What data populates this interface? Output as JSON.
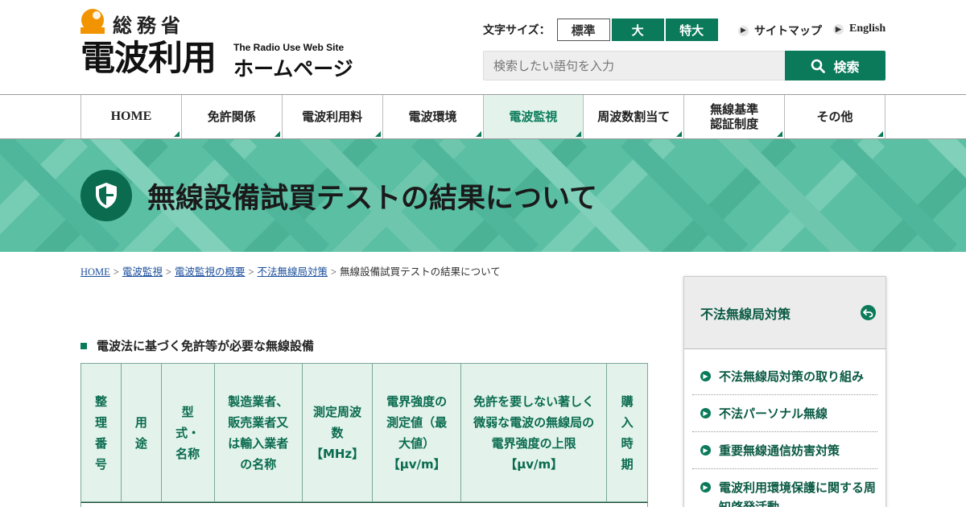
{
  "colors": {
    "brand_green": "#0a7a5a",
    "logo_orange": "#f29400",
    "link_blue": "#1b4f9c"
  },
  "header": {
    "logo": {
      "ministry": "総務省",
      "main": "電波利用",
      "sub_en": "The Radio Use Web Site",
      "sub_ja": "ホームページ"
    },
    "font_size": {
      "label": "文字サイズ：",
      "standard": "標準",
      "large": "大",
      "extra_large": "特大"
    },
    "links": {
      "sitemap": "サイトマップ",
      "english": "English"
    },
    "search": {
      "placeholder": "検索したい語句を入力",
      "button": "検索",
      "icon": "search-icon"
    }
  },
  "nav": {
    "items": [
      {
        "label": "HOME"
      },
      {
        "label": "免許関係"
      },
      {
        "label": "電波利用料"
      },
      {
        "label": "電波環境"
      },
      {
        "label": "電波監視",
        "active": true
      },
      {
        "label": "周波数割当て"
      },
      {
        "label": "無線基準\n認証制度"
      },
      {
        "label": "その他"
      }
    ]
  },
  "banner": {
    "title": "無線設備試買テストの結果について",
    "icon": "shield-icon"
  },
  "breadcrumb": {
    "items": [
      {
        "label": "HOME"
      },
      {
        "label": "電波監視"
      },
      {
        "label": "電波監視の概要"
      },
      {
        "label": "不法無線局対策"
      }
    ],
    "separator": ">",
    "current": "無線設備試買テストの結果について"
  },
  "main": {
    "section_heading": "電波法に基づく免許等が必要な無線設備",
    "table": {
      "headers": [
        "整理番号",
        "用途",
        "型式・名称",
        "製造業者、販売業者又は輸入業者の名称",
        "測定周波数【MHz】",
        "電界強度の測定値（最大値）【μv/m】",
        "免許を要しない著しく微弱な電波の無線局の電界強度の上限【μv/m】",
        "購入時期"
      ]
    }
  },
  "sidebar": {
    "title": "不法無線局対策",
    "back_icon": "return-icon",
    "items": [
      {
        "label": "不法無線局対策の取り組み"
      },
      {
        "label": "不法パーソナル無線"
      },
      {
        "label": "重要無線通信妨害対策"
      },
      {
        "label": "電波利用環境保護に関する周知啓発活動"
      }
    ]
  }
}
